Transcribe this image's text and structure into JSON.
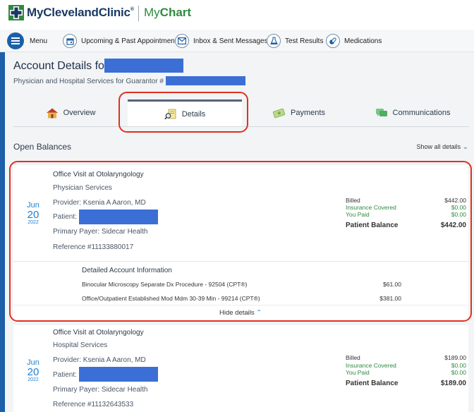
{
  "brand": {
    "name": "MyClevelandClinic",
    "reg": "®",
    "app_prefix": "My",
    "app_suffix": "Chart"
  },
  "nav": {
    "menu": "Menu",
    "items": [
      {
        "label": "Upcoming & Past Appointments",
        "icon": "calendar-icon"
      },
      {
        "label": "Inbox & Sent Messages",
        "icon": "envelope-icon"
      },
      {
        "label": "Test Results",
        "icon": "flask-icon"
      },
      {
        "label": "Medications",
        "icon": "pills-icon"
      }
    ]
  },
  "page": {
    "title": "Account Details for",
    "subtitle": "Physician and Hospital Services for Guarantor #"
  },
  "tabs": [
    {
      "label": "Overview",
      "icon": "house-icon"
    },
    {
      "label": "Details",
      "icon": "magnifier-document-icon",
      "active": true
    },
    {
      "label": "Payments",
      "icon": "money-icon"
    },
    {
      "label": "Communications",
      "icon": "chat-bubbles-icon"
    }
  ],
  "open_balances": {
    "title": "Open Balances",
    "show_all": "Show all details",
    "show_all_chevron": "⌄"
  },
  "visits": [
    {
      "title": "Office Visit at Otolaryngology",
      "service": "Physician Services",
      "month": "Jun",
      "day": "20",
      "year": "2022",
      "provider": "Provider: Ksenia A Aaron, MD",
      "patient_label": "Patient:",
      "payer": "Primary Payer: Sidecar Health",
      "reference": "Reference #11133880017",
      "billed_label": "Billed",
      "billed": "$442.00",
      "insurance_label": "Insurance Covered",
      "insurance": "$0.00",
      "paid_label": "You Paid",
      "paid": "$0.00",
      "balance_label": "Patient Balance",
      "balance": "$442.00",
      "details_title": "Detailed Account Information",
      "details": [
        {
          "desc": "Binocular Microscopy Separate Dx Procedure - 92504 (CPT®)",
          "amount": "$61.00"
        },
        {
          "desc": "Office/Outpatient Established Mod Mdm 30-39 Min - 99214 (CPT®)",
          "amount": "$381.00"
        }
      ],
      "hide_details": "Hide details",
      "hide_chevron": "⌃"
    },
    {
      "title": "Office Visit at Otolaryngology",
      "service": "Hospital Services",
      "month": "Jun",
      "day": "20",
      "year": "2022",
      "provider": "Provider: Ksenia A Aaron, MD",
      "patient_label": "Patient:",
      "payer": "Primary Payer: Sidecar Health",
      "reference": "Reference #11132643533",
      "billed_label": "Billed",
      "billed": "$189.00",
      "insurance_label": "Insurance Covered",
      "insurance": "$0.00",
      "paid_label": "You Paid",
      "paid": "$0.00",
      "balance_label": "Patient Balance",
      "balance": "$189.00"
    }
  ],
  "colors": {
    "brand_blue": "#1d5fa8",
    "link_blue": "#1d7fd0",
    "green": "#2e8a3f",
    "highlight_red": "#e0301e",
    "redaction": "#3b6fd6"
  }
}
